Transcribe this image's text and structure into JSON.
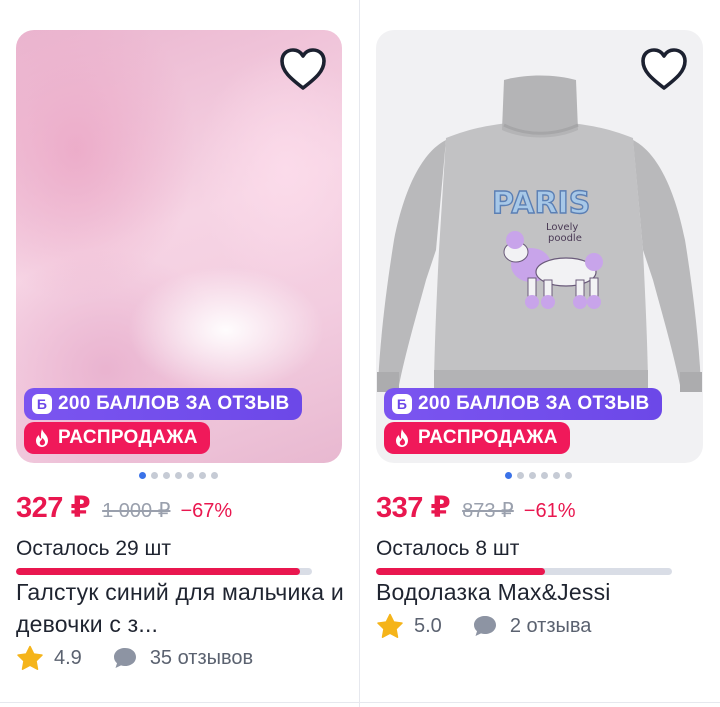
{
  "products": [
    {
      "points_badge": "200 БАЛЛОВ ЗА ОТЗЫВ",
      "points_icon_letter": "Б",
      "sale_badge": "РАСПРОДАЖА",
      "price": "327 ₽",
      "old_price": "1 000 ₽",
      "discount": "−67%",
      "stock_text": "Осталось 29 шт",
      "stock_level": 0.96,
      "title": "Галстук синий для мальчика и девочки с з...",
      "rating": "4.9",
      "reviews": "35 отзывов",
      "image_count": 7,
      "active_image": 0
    },
    {
      "points_badge": "200 БАЛЛОВ ЗА ОТЗЫВ",
      "points_icon_letter": "Б",
      "sale_badge": "РАСПРОДАЖА",
      "price": "337 ₽",
      "old_price": "873 ₽",
      "discount": "−61%",
      "stock_text": "Осталось 8 шт",
      "stock_level": 0.57,
      "title": "Водолазка Max&Jessi",
      "rating": "5.0",
      "reviews": "2 отзыва",
      "image_count": 6,
      "active_image": 0,
      "image_print": {
        "line1": "PARIS",
        "line2": "Lovely",
        "line3": "poodle"
      }
    }
  ],
  "icons": {
    "favorite": "heart-outline-icon",
    "sale": "fire-icon",
    "rating": "star-icon",
    "reviews": "chat-bubble-icon"
  },
  "colors": {
    "accent": "#e9174f",
    "points_badge": "#6c48e8",
    "sale_badge": "#f0195a",
    "active_dot": "#3a72e8",
    "star": "#f5b41a"
  }
}
